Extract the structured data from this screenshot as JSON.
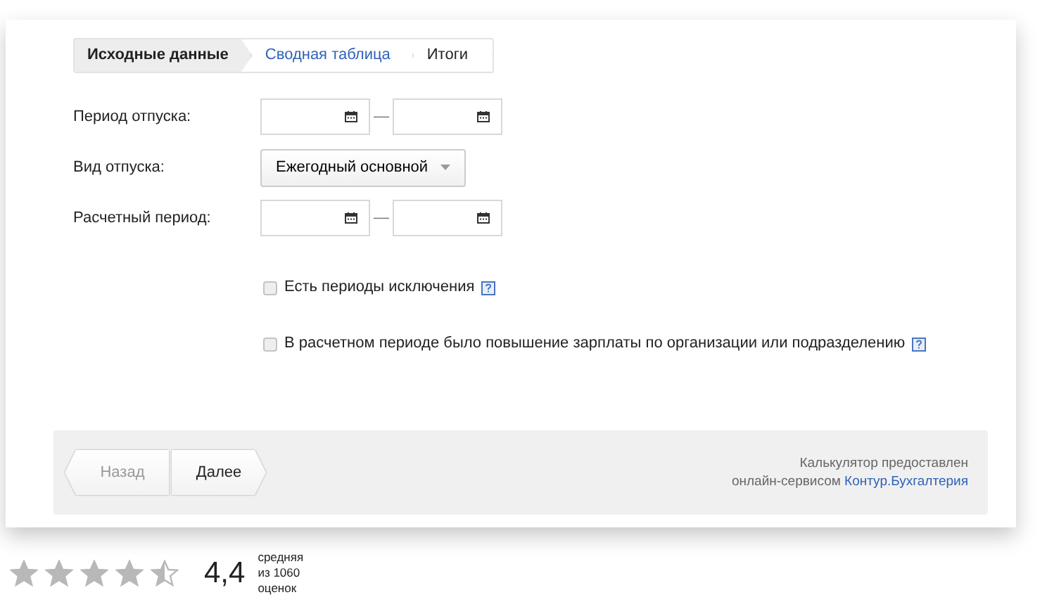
{
  "steps": [
    {
      "label": "Исходные данные",
      "selected": true,
      "link": false
    },
    {
      "label": "Сводная таблица",
      "selected": false,
      "link": true
    },
    {
      "label": "Итоги",
      "selected": false,
      "link": false
    }
  ],
  "fields": [
    {
      "kind": "date_range",
      "label": "Период отпуска:",
      "separator": "—"
    },
    {
      "kind": "select",
      "label": "Вид отпуска:",
      "value": "Ежегодный основной"
    },
    {
      "kind": "date_range",
      "label": "Расчетный период:",
      "separator": "—"
    }
  ],
  "options": [
    {
      "label": "Есть периоды исключения",
      "checked": false
    },
    {
      "label": "В расчетном периоде было повышение зарплаты по организации или подразделению",
      "checked": false
    }
  ],
  "buttons": [
    {
      "label": "Назад",
      "kind": "back",
      "disabled": true
    },
    {
      "label": "Далее",
      "kind": "next",
      "disabled": false
    }
  ],
  "credit": {
    "line1": "Калькулятор предоставлен",
    "line2": "онлайн-сервисом",
    "link": "Контур.Бухгалтерия"
  },
  "rating": {
    "stars": 4.5,
    "score": "4,4",
    "caption": [
      "средняя",
      "из 1060",
      "оценок"
    ]
  }
}
